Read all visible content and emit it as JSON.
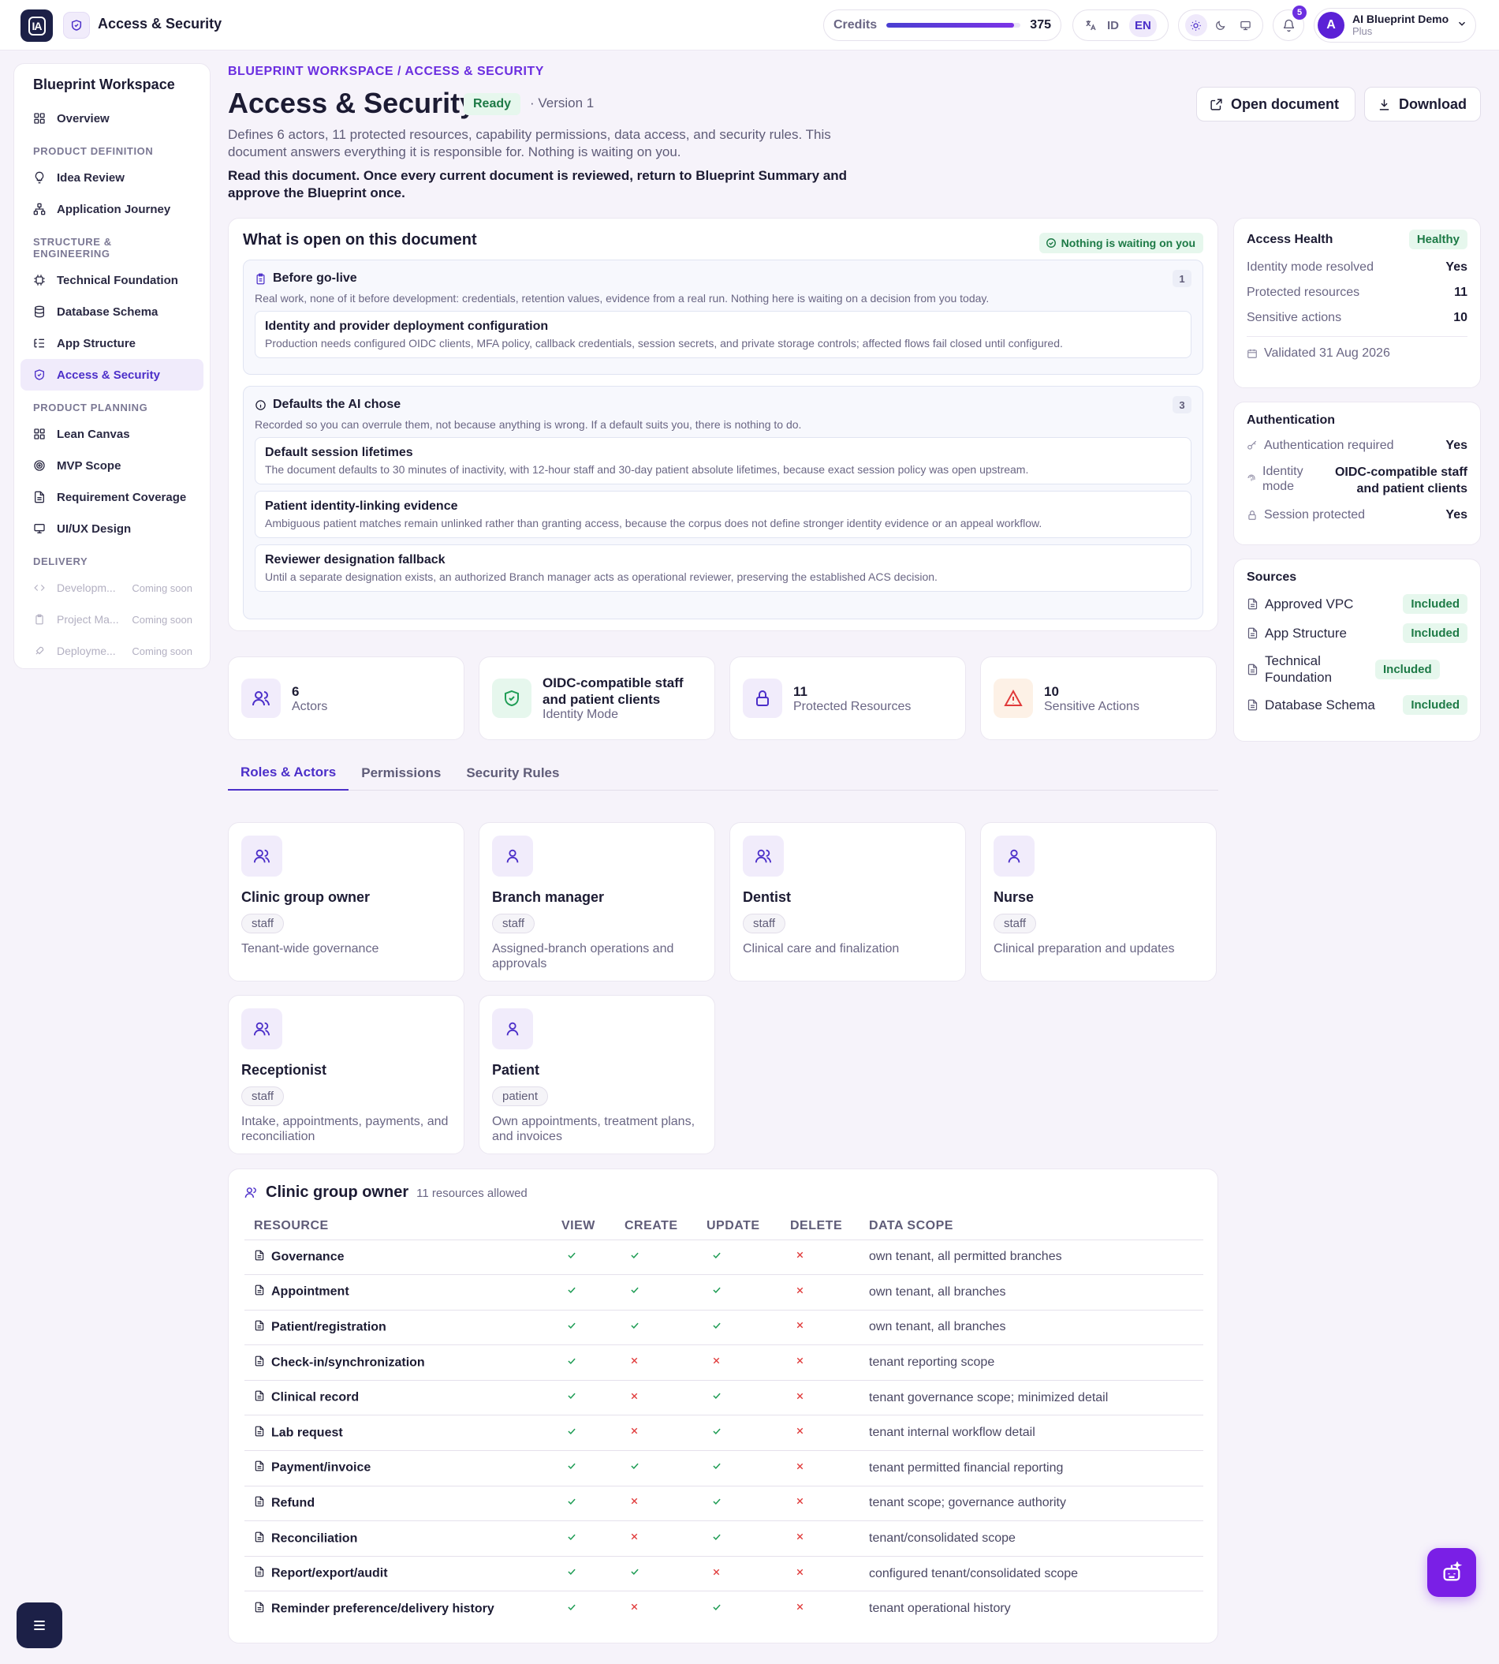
{
  "topbar": {
    "logo": "IA",
    "title": "Access & Security",
    "credits_label": "Credits",
    "credits_value": "375",
    "credits_fraction": 0.95,
    "lang_id": "ID",
    "lang_en": "EN",
    "notifications": "5",
    "user_initial": "A",
    "user_name": "AI Blueprint Demo",
    "user_plan": "Plus"
  },
  "sidebar": {
    "workspace": "Blueprint Workspace",
    "overview": "Overview",
    "sections": {
      "product_definition": "PRODUCT DEFINITION",
      "structure": "STRUCTURE & ENGINEERING",
      "planning": "PRODUCT PLANNING",
      "delivery": "DELIVERY"
    },
    "items": {
      "idea_review": "Idea Review",
      "application_journey": "Application Journey",
      "technical_foundation": "Technical Foundation",
      "database_schema": "Database Schema",
      "app_structure": "App Structure",
      "access_security": "Access & Security",
      "lean_canvas": "Lean Canvas",
      "mvp_scope": "MVP Scope",
      "requirement_coverage": "Requirement Coverage",
      "uiux_design": "UI/UX Design",
      "development": "Developm...",
      "project_management": "Project Ma...",
      "deployment": "Deployme..."
    },
    "coming_soon": "Coming soon"
  },
  "header": {
    "breadcrumb": "BLUEPRINT WORKSPACE / ACCESS & SECURITY",
    "title": "Access & Security",
    "status": "Ready",
    "version": "· Version 1",
    "description": "Defines 6 actors, 11 protected resources, capability permissions, data access, and security rules. This document answers everything it is responsible for. Nothing is waiting on you.",
    "instruction": "Read this document. Once every current document is reviewed, return to Blueprint Summary and approve the Blueprint once.",
    "open_document": "Open document",
    "download": "Download"
  },
  "open_items": {
    "title": "What is open on this document",
    "status": "Nothing is waiting on you",
    "before_golive": {
      "title": "Before go-live",
      "count": "1",
      "subtitle": "Real work, none of it before development: credentials, retention values, evidence from a real run. Nothing here is waiting on a decision from you today.",
      "items": [
        {
          "title": "Identity and provider deployment configuration",
          "desc": "Production needs configured OIDC clients, MFA policy, callback credentials, session secrets, and private storage controls; affected flows fail closed until configured."
        }
      ]
    },
    "defaults": {
      "title": "Defaults the AI chose",
      "count": "3",
      "subtitle": "Recorded so you can overrule them, not because anything is wrong. If a default suits you, there is nothing to do.",
      "items": [
        {
          "title": "Default session lifetimes",
          "desc": "The document defaults to 30 minutes of inactivity, with 12-hour staff and 30-day patient absolute lifetimes, because exact session policy was open upstream."
        },
        {
          "title": "Patient identity-linking evidence",
          "desc": "Ambiguous patient matches remain unlinked rather than granting access, because the corpus does not define stronger identity evidence or an appeal workflow."
        },
        {
          "title": "Reviewer designation fallback",
          "desc": "Until a separate designation exists, an authorized Branch manager acts as operational reviewer, preserving the established ACS decision."
        }
      ]
    }
  },
  "stats": [
    {
      "value": "6",
      "label": "Actors"
    },
    {
      "value": "OIDC-compatible staff and patient clients",
      "label": "Identity Mode"
    },
    {
      "value": "11",
      "label": "Protected Resources"
    },
    {
      "value": "10",
      "label": "Sensitive Actions"
    }
  ],
  "tabs": [
    "Roles & Actors",
    "Permissions",
    "Security Rules"
  ],
  "roles": [
    {
      "name": "Clinic group owner",
      "type": "staff",
      "desc": "Tenant-wide governance"
    },
    {
      "name": "Branch manager",
      "type": "staff",
      "desc": "Assigned-branch operations and approvals"
    },
    {
      "name": "Dentist",
      "type": "staff",
      "desc": "Clinical care and finalization"
    },
    {
      "name": "Nurse",
      "type": "staff",
      "desc": "Clinical preparation and updates"
    },
    {
      "name": "Receptionist",
      "type": "staff",
      "desc": "Intake, appointments, payments, and reconciliation"
    },
    {
      "name": "Patient",
      "type": "patient",
      "desc": "Own appointments, treatment plans, and invoices"
    }
  ],
  "permissions": {
    "role": "Clinic group owner",
    "summary": "11 resources allowed",
    "columns": [
      "RESOURCE",
      "VIEW",
      "CREATE",
      "UPDATE",
      "DELETE",
      "DATA SCOPE"
    ],
    "rows": [
      {
        "resource": "Governance",
        "view": true,
        "create": true,
        "update": true,
        "delete": false,
        "scope": "own tenant, all permitted branches"
      },
      {
        "resource": "Appointment",
        "view": true,
        "create": true,
        "update": true,
        "delete": false,
        "scope": "own tenant, all branches"
      },
      {
        "resource": "Patient/registration",
        "view": true,
        "create": true,
        "update": true,
        "delete": false,
        "scope": "own tenant, all branches"
      },
      {
        "resource": "Check-in/synchronization",
        "view": true,
        "create": false,
        "update": false,
        "delete": false,
        "scope": "tenant reporting scope"
      },
      {
        "resource": "Clinical record",
        "view": true,
        "create": false,
        "update": true,
        "delete": false,
        "scope": "tenant governance scope; minimized detail"
      },
      {
        "resource": "Lab request",
        "view": true,
        "create": false,
        "update": true,
        "delete": false,
        "scope": "tenant internal workflow detail"
      },
      {
        "resource": "Payment/invoice",
        "view": true,
        "create": true,
        "update": true,
        "delete": false,
        "scope": "tenant permitted financial reporting"
      },
      {
        "resource": "Refund",
        "view": true,
        "create": false,
        "update": true,
        "delete": false,
        "scope": "tenant scope; governance authority"
      },
      {
        "resource": "Reconciliation",
        "view": true,
        "create": false,
        "update": true,
        "delete": false,
        "scope": "tenant/consolidated scope"
      },
      {
        "resource": "Report/export/audit",
        "view": true,
        "create": true,
        "update": false,
        "delete": false,
        "scope": "configured tenant/consolidated scope"
      },
      {
        "resource": "Reminder preference/delivery history",
        "view": true,
        "create": false,
        "update": true,
        "delete": false,
        "scope": "tenant operational history"
      }
    ]
  },
  "access_health": {
    "title": "Access Health",
    "status": "Healthy",
    "rows": [
      {
        "label": "Identity mode resolved",
        "value": "Yes"
      },
      {
        "label": "Protected resources",
        "value": "11"
      },
      {
        "label": "Sensitive actions",
        "value": "10"
      }
    ],
    "validated": "Validated 31 Aug 2026"
  },
  "authentication": {
    "title": "Authentication",
    "required_label": "Authentication required",
    "required_value": "Yes",
    "mode_label": "Identity mode",
    "mode_value": "OIDC-compatible staff and patient clients",
    "session_label": "Session protected",
    "session_value": "Yes"
  },
  "sources": {
    "title": "Sources",
    "items": [
      {
        "name": "Approved VPC",
        "status": "Included"
      },
      {
        "name": "App Structure",
        "status": "Included"
      },
      {
        "name": "Technical Foundation",
        "status": "Included"
      },
      {
        "name": "Database Schema",
        "status": "Included"
      }
    ]
  },
  "colors": {
    "accent": "#4c2fc9",
    "brand_dark": "#1c2047",
    "success": "#1f9d55",
    "danger": "#e03a3a"
  }
}
